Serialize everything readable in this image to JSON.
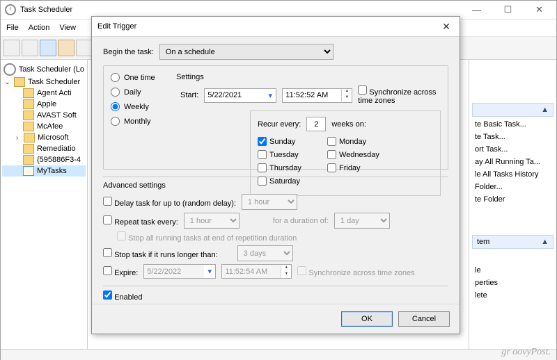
{
  "window": {
    "title": "Task Scheduler"
  },
  "menu": {
    "file": "File",
    "action": "Action",
    "view": "View"
  },
  "tree": {
    "root": "Task Scheduler (Lo",
    "lib": "Task Scheduler",
    "items": [
      "Agent Acti",
      "Apple",
      "AVAST Soft",
      "McAfee",
      "Microsoft",
      "Remediatio",
      "{595886F3-4"
    ],
    "selected": "MyTasks"
  },
  "actions_panel": {
    "items_top": [
      "te Basic Task...",
      "te Task...",
      "ort Task...",
      "ay All Running Ta...",
      "le All Tasks History",
      "Folder...",
      "te Folder"
    ],
    "header2": "tem",
    "items_bottom": [
      "le",
      "perties",
      "lete"
    ]
  },
  "dialog": {
    "title": "Edit Trigger",
    "begin_label": "Begin the task:",
    "begin_value": "On a schedule",
    "settings_legend": "Settings",
    "opt_onetime": "One time",
    "opt_daily": "Daily",
    "opt_weekly": "Weekly",
    "opt_monthly": "Monthly",
    "start_label": "Start:",
    "start_date": "5/22/2021",
    "start_time": "11:52:52 AM",
    "sync_label": "Synchronize across time zones",
    "recur_label1": "Recur every:",
    "recur_value": "2",
    "recur_label2": "weeks on:",
    "day_sun": "Sunday",
    "day_mon": "Monday",
    "day_tue": "Tuesday",
    "day_wed": "Wednesday",
    "day_thu": "Thursday",
    "day_fri": "Friday",
    "day_sat": "Saturday",
    "adv_legend": "Advanced settings",
    "delay_label": "Delay task for up to (random delay):",
    "delay_value": "1 hour",
    "repeat_label": "Repeat task every:",
    "repeat_value": "1 hour",
    "duration_label": "for a duration of:",
    "duration_value": "1 day",
    "stopall_label": "Stop all running tasks at end of repetition duration",
    "stoplong_label": "Stop task if it runs longer than:",
    "stoplong_value": "3 days",
    "expire_label": "Expire:",
    "expire_date": "5/22/2022",
    "expire_time": "11:52:54 AM",
    "sync2_label": "Synchronize across time zones",
    "enabled_label": "Enabled",
    "ok": "OK",
    "cancel": "Cancel"
  },
  "watermark": "gr oovyPost."
}
